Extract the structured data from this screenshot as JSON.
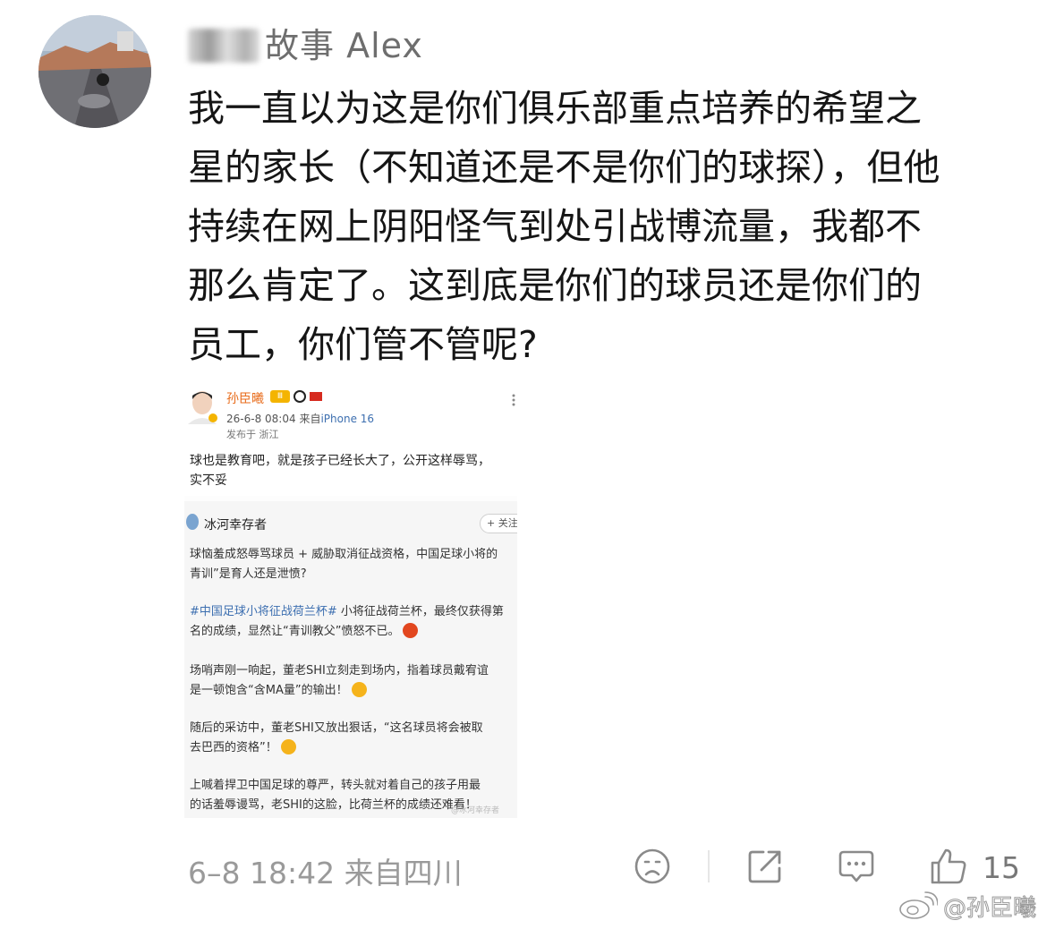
{
  "comment": {
    "username": "故事 Alex",
    "text_lines": [
      "我一直以为这是你们俱乐部重点培养的希望之",
      "星的家长（不知道还是不是你们的球探），但他",
      "持续在网上阴阳怪气到处引战博流量，我都不",
      "那么肯定了。这到底是你们的球员还是你们的",
      "员工，你们管不管呢?"
    ],
    "time": "6–8 18:42",
    "source": "来自四川",
    "like_count": "15"
  },
  "embedded_post": {
    "author": "孙臣曦",
    "badge": "Ⅲ",
    "time": "26-6-8 08:04",
    "device_prefix": "来自",
    "device": "iPhone 16",
    "location": "发布于 浙江",
    "body_lines": [
      "球也是教育吧，就是孩子已经长大了，公开这样辱骂，",
      "实不妥"
    ],
    "repost": {
      "author": "冰河幸存者",
      "follow_label": "+ 关注",
      "paragraphs": [
        [
          "球恼羞成怒辱骂球员 + 威胁取消征战资格，中国足球小将的",
          "青训”是育人还是泄愤?"
        ],
        [
          "#中国足球小将征战荷兰杯# 小将征战荷兰杯，最终仅获得第",
          "名的成绩，显然让“青训教父”愤怒不已。"
        ],
        [
          "场哨声刚一响起，董老SHI立刻走到场内，指着球员戴宥谊",
          "是一顿饱含“含MA量”的输出！"
        ],
        [
          "随后的采访中，董老SHI又放出狠话，“这名球员将会被取",
          "去巴西的资格”！"
        ],
        [
          "上喊着捍卫中国足球的尊严，转头就对着自己的孩子用最",
          "的话羞辱谩骂，老SHI的这脸，比荷兰杯的成绩还难看！"
        ]
      ],
      "watermark": "@冰河幸存者"
    }
  },
  "watermark_text": "@孙臣曦",
  "colors": {
    "text": "#151515",
    "meta_gray": "#9a9a9a",
    "link_blue": "#3d6fb0",
    "orange_name": "#e86b1a"
  },
  "icons": [
    "sad-face-icon",
    "share-icon",
    "comment-icon",
    "thumbs-up-icon",
    "weibo-logo-icon"
  ]
}
